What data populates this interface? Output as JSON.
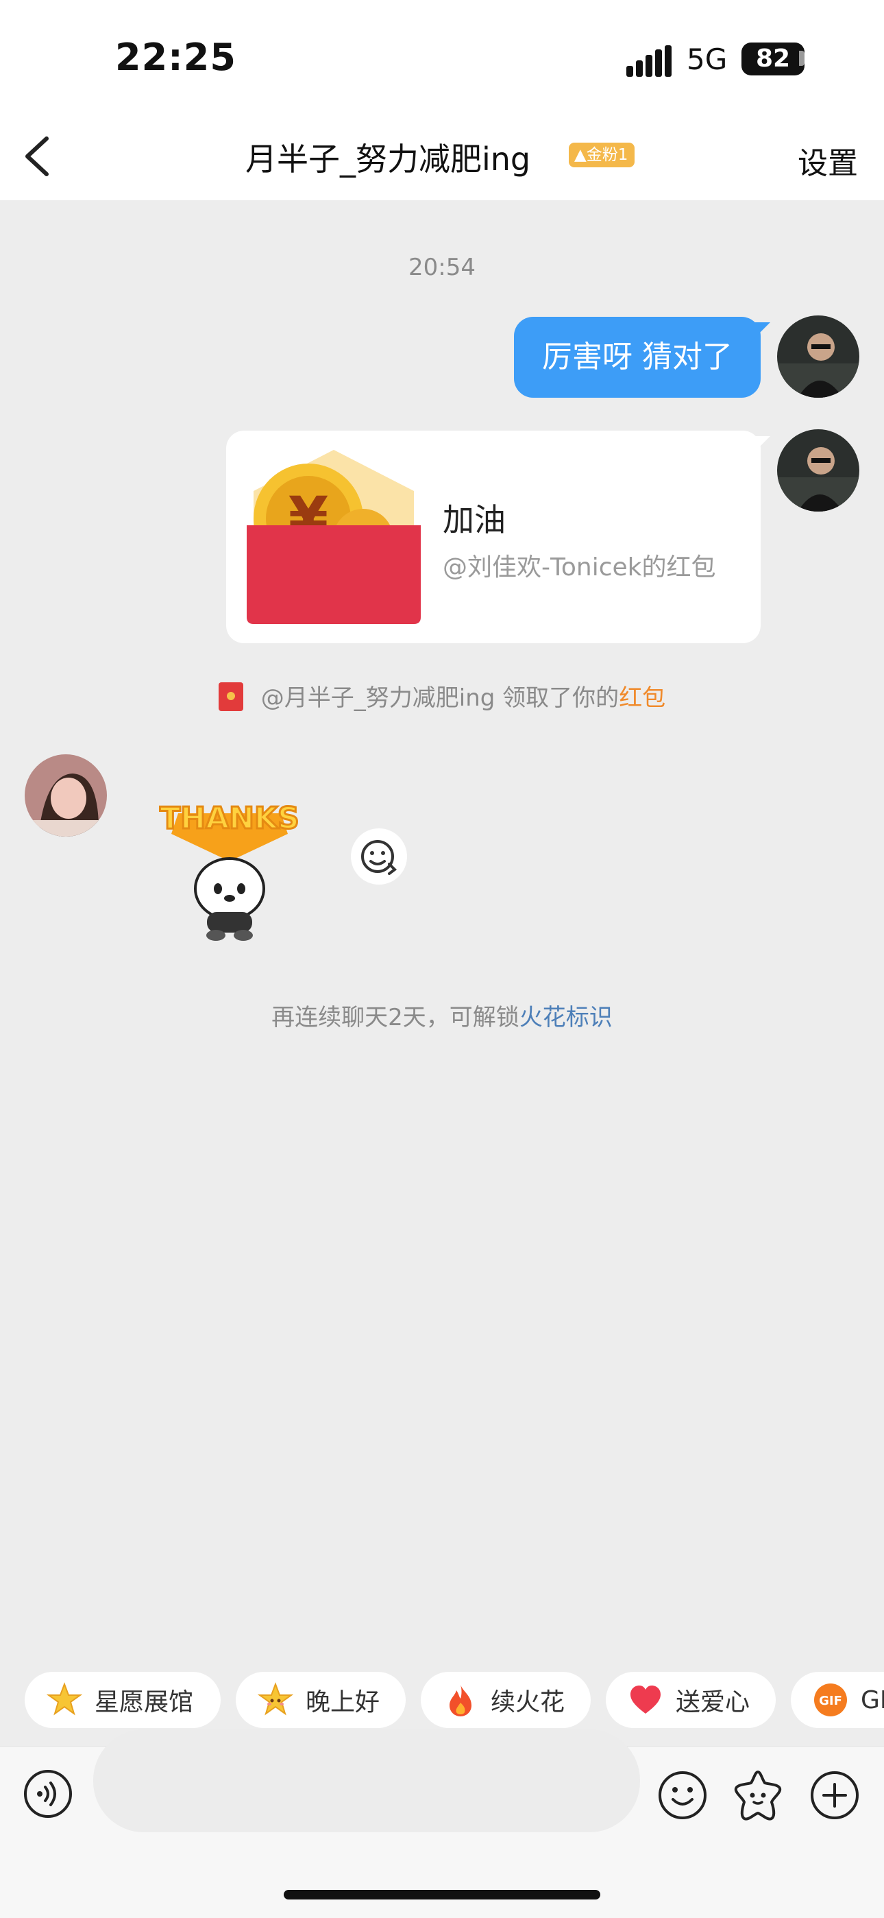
{
  "status_bar": {
    "time": "22:25",
    "network": "5G",
    "battery": "82"
  },
  "header": {
    "back_icon": "chevron-left-icon",
    "title": "月半子_努力减肥ing",
    "fan_badge": "金粉1",
    "settings_label": "设置"
  },
  "chat": {
    "timestamp": "20:54",
    "messages": [
      {
        "side": "right",
        "type": "text",
        "text": "厉害呀 猜对了"
      },
      {
        "side": "right",
        "type": "red_packet",
        "title": "加油",
        "subtitle": "@刘佳欢-Tonicek的红包"
      },
      {
        "side": "left",
        "type": "sticker",
        "sticker_text": "THANKS"
      }
    ],
    "packet_notice": {
      "prefix": "@月半子_努力减肥ing 领取了你的",
      "highlight": "红包"
    },
    "streak_notice": {
      "prefix": "再连续聊天2天，可解锁",
      "link": "火花标识"
    }
  },
  "quick_actions": [
    {
      "icon": "star-icon",
      "label": "星愿展馆"
    },
    {
      "icon": "smiling-star-icon",
      "label": "晚上好"
    },
    {
      "icon": "fire-icon",
      "label": "续火花"
    },
    {
      "icon": "heart-icon",
      "label": "送爱心"
    },
    {
      "icon": "gif-icon",
      "label": "GI"
    }
  ],
  "input_bar": {
    "voice_icon": "voice-icon",
    "emoji_icon": "emoji-icon",
    "sticker_icon": "sticker-star-icon",
    "add_icon": "plus-icon",
    "placeholder": ""
  },
  "colors": {
    "accent_blue": "#3d9df7",
    "highlight_orange": "#f08a2b",
    "link_blue": "#4d7fb8",
    "red_packet": "#e1344a"
  }
}
